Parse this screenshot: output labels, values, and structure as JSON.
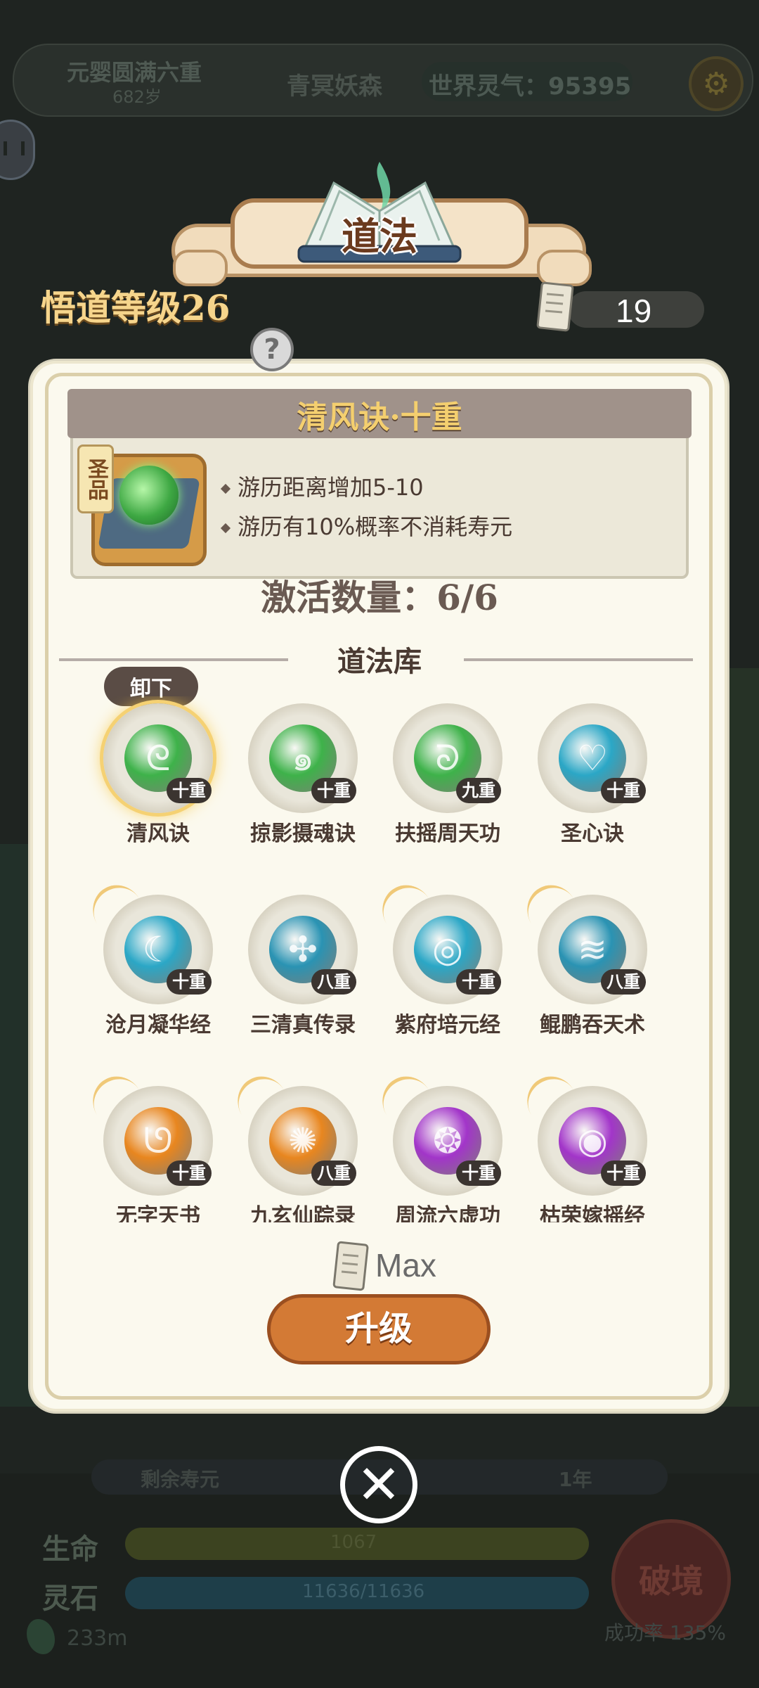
{
  "background": {
    "realm": "元婴圆满六重",
    "age": "682岁",
    "location": "青冥妖森",
    "world_qi": "世界灵气：95395",
    "remaining_life_label": "剩余寿元",
    "remaining_life_value": "1年",
    "hp_label": "生命",
    "hp_value": "1067",
    "stone_label": "灵石",
    "stone_value": "11636/11636",
    "distance": "233m",
    "breakthrough_label": "破境",
    "success_rate": "成功率 135%"
  },
  "header": {
    "title": "道法",
    "comprehension": "悟道等级26",
    "scroll_count": "19",
    "help": "?"
  },
  "detail": {
    "title": "清风诀·十重",
    "grade": "圣品",
    "effects": [
      "游历距离增加5-10",
      "游历有10%概率不消耗寿元"
    ],
    "activation": "激活数量：6/6"
  },
  "library": {
    "title": "道法库",
    "unequip_label": "卸下",
    "skills": [
      {
        "name": "清风诀",
        "level": "十重",
        "color": "#3eb24a",
        "glyph": "ᘓ"
      },
      {
        "name": "掠影摄魂诀",
        "level": "十重",
        "color": "#3eb24a",
        "glyph": "๑"
      },
      {
        "name": "扶摇周天功",
        "level": "九重",
        "color": "#3eb24a",
        "glyph": "ᘐ"
      },
      {
        "name": "圣心诀",
        "level": "十重",
        "color": "#2ba7c6",
        "glyph": "♡"
      },
      {
        "name": "沧月凝华经",
        "level": "十重",
        "color": "#2ba7c6",
        "glyph": "☾"
      },
      {
        "name": "三清真传录",
        "level": "八重",
        "color": "#2a93b3",
        "glyph": "✣"
      },
      {
        "name": "紫府培元经",
        "level": "十重",
        "color": "#2ba7c6",
        "glyph": "◎"
      },
      {
        "name": "鲲鹏吞天术",
        "level": "八重",
        "color": "#2a93b3",
        "glyph": "≋"
      },
      {
        "name": "无字天书",
        "level": "十重",
        "color": "#e8861f",
        "glyph": "ᘎ"
      },
      {
        "name": "九玄仙踪录",
        "level": "八重",
        "color": "#e8861f",
        "glyph": "✺"
      },
      {
        "name": "周流六虚功",
        "level": "十重",
        "color": "#a235c9",
        "glyph": "❂"
      },
      {
        "name": "枯荣嫁摇经",
        "level": "十重",
        "color": "#a235c9",
        "glyph": "◉"
      }
    ]
  },
  "footer": {
    "max_label": "Max",
    "upgrade_label": "升级",
    "close_label": "✕"
  }
}
